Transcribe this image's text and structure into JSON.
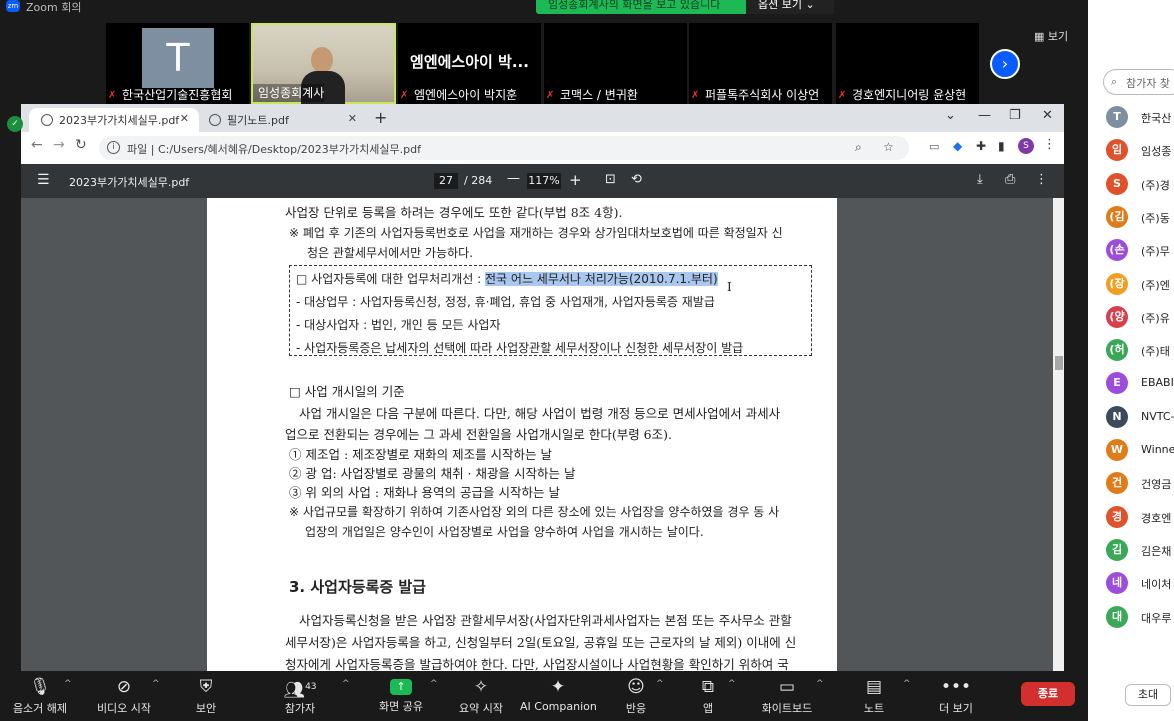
{
  "app": {
    "title": "Zoom 회의",
    "logo": "zm"
  },
  "banner": {
    "message": "임성종회계사의 화면을 보고 있습니다",
    "options_label": "옵션 보기"
  },
  "view_button": {
    "label": "보기"
  },
  "gallery": {
    "tiles": [
      {
        "name": "한국산업기술진흥협회",
        "avatar_letter": "T",
        "muted": true
      },
      {
        "name": "임성종회계사",
        "muted": false
      },
      {
        "name": "엠엔에스아이 박지훈",
        "big_name": "엠엔에스아이 박...",
        "muted": true
      },
      {
        "name": "코맥스 / 변귀환",
        "muted": true
      },
      {
        "name": "퍼플톡주식회사 이상언",
        "muted": true
      },
      {
        "name": "경호엔지니어링 윤상현",
        "muted": true
      }
    ]
  },
  "browser": {
    "tabs": [
      {
        "label": "2023부가가치세실무.pdf",
        "active": true
      },
      {
        "label": "필기노트.pdf",
        "active": false
      }
    ],
    "new_tab": "+",
    "url": "파일 | C:/Users/혜서혜유/Desktop/2023부가가치세실무.pdf",
    "profile_letter": "S"
  },
  "pdf": {
    "title": "2023부가가치세실무.pdf",
    "page_current": "27",
    "page_total": "/ 284",
    "zoom": "117%",
    "lines": {
      "l1": "사업장 단위로 등록을 하려는 경우에도 또한 같다(부법 8조 4항).",
      "l2": "※ 폐업 후 기존의 사업자등록번호로 사업을 재개하는 경우와 상가임대차보호법에 따른 확정일자 신",
      "l3": "청은 관할세무서에서만 가능하다.",
      "box1_prefix": "□ 사업자등록에 대한 업무처리개선 : ",
      "box1_highlight": "전국 어느 세무서나 처리가능(2010.7.1.부터)",
      "box2": "- 대상업무 : 사업자등록신청, 정정, 휴·폐업, 휴업 중 사업재개, 사업자등록증 재발급",
      "box3": "- 대상사업자 : 법인, 개인 등 모든 사업자",
      "box4": "- 사업자등록증은 납세자의 선택에 따라 사업장관할 세무서장이나 신청한 세무서장이 발급",
      "s1": "□ 사업 개시일의 기준",
      "p1": "사업 개시일은 다음 구분에 따른다. 다만, 해당 사업이 법령 개정 등으로 면세사업에서 과세사",
      "p2": "업으로 전환되는 경우에는 그 과세 전환일을 사업개시일로 한다(부령 6조).",
      "i1": "① 제조업 : 제조장별로 재화의 제조를 시작하는 날",
      "i2": "② 광   업: 사업장별로 광물의 채취 · 채광을 시작하는 날",
      "i3": "③ 위 외의 사업 : 재화나 용역의 공급을 시작하는 날",
      "n1": "※ 사업규모를 확장하기 위하여 기존사업장 외의 다른 장소에 있는 사업장을 양수하였을 경우 동 사",
      "n2": "업장의 개업일은 양수인이 사업장별로 사업을 양수하여 사업을 개시하는 날이다.",
      "h3": "3. 사업자등록증 발급",
      "q1": "사업자등록신청을 받은 사업장 관할세무서장(사업자단위과세사업자는 본점 또는 주사무소 관할",
      "q2": "세무서장)은 사업자등록을 하고, 신청일부터 2일(토요일, 공휴일 또는 근로자의 날 제외) 이내에 신",
      "q3": "청자에게 사업자등록증을 발급하여야 한다. 다만, 사업장시설이나 사업현황을 확인하기 위하여 국"
    }
  },
  "participants": {
    "search_placeholder": "참가자 찾",
    "items": [
      {
        "avatar": "T",
        "name": "한국산",
        "color": "#7d8fa0"
      },
      {
        "avatar": "임",
        "name": "임성종",
        "color": "#e0522c"
      },
      {
        "avatar": "S",
        "name": "(주)경",
        "color": "#e0522c"
      },
      {
        "avatar": "(김",
        "name": "(주)동",
        "color": "#e07b1a"
      },
      {
        "avatar": "(손",
        "name": "(주)무",
        "color": "#9c4ddb"
      },
      {
        "avatar": "(장",
        "name": "(주)엔",
        "color": "#f0a020"
      },
      {
        "avatar": "(양",
        "name": "(주)유",
        "color": "#d6404e"
      },
      {
        "avatar": "(허",
        "name": "(주)태",
        "color": "#3aa856"
      },
      {
        "avatar": "E",
        "name": "EBABIC",
        "color": "#9c4ddb"
      },
      {
        "avatar": "N",
        "name": "NVTC-",
        "color": "#3b4b5c"
      },
      {
        "avatar": "W",
        "name": "Winne",
        "color": "#e07b1a"
      },
      {
        "avatar": "건",
        "name": "건영금",
        "color": "#e07b1a"
      },
      {
        "avatar": "경",
        "name": "경호엔",
        "color": "#e0522c"
      },
      {
        "avatar": "김",
        "name": "김은채",
        "color": "#3aa856"
      },
      {
        "avatar": "네",
        "name": "네이처",
        "color": "#9c4ddb"
      },
      {
        "avatar": "대",
        "name": "대우루",
        "color": "#3aa856"
      }
    ],
    "invite_label": "초대"
  },
  "controls": {
    "mute": "음소거 해제",
    "video": "비디오 시작",
    "security": "보안",
    "participants": "참가자",
    "participants_count": "43",
    "share": "화면 공유",
    "summary": "요약 시작",
    "companion": "AI Companion",
    "reactions": "반응",
    "apps": "앱",
    "whiteboard": "화이트보드",
    "notes": "노트",
    "more": "더 보기",
    "end": "종료"
  }
}
